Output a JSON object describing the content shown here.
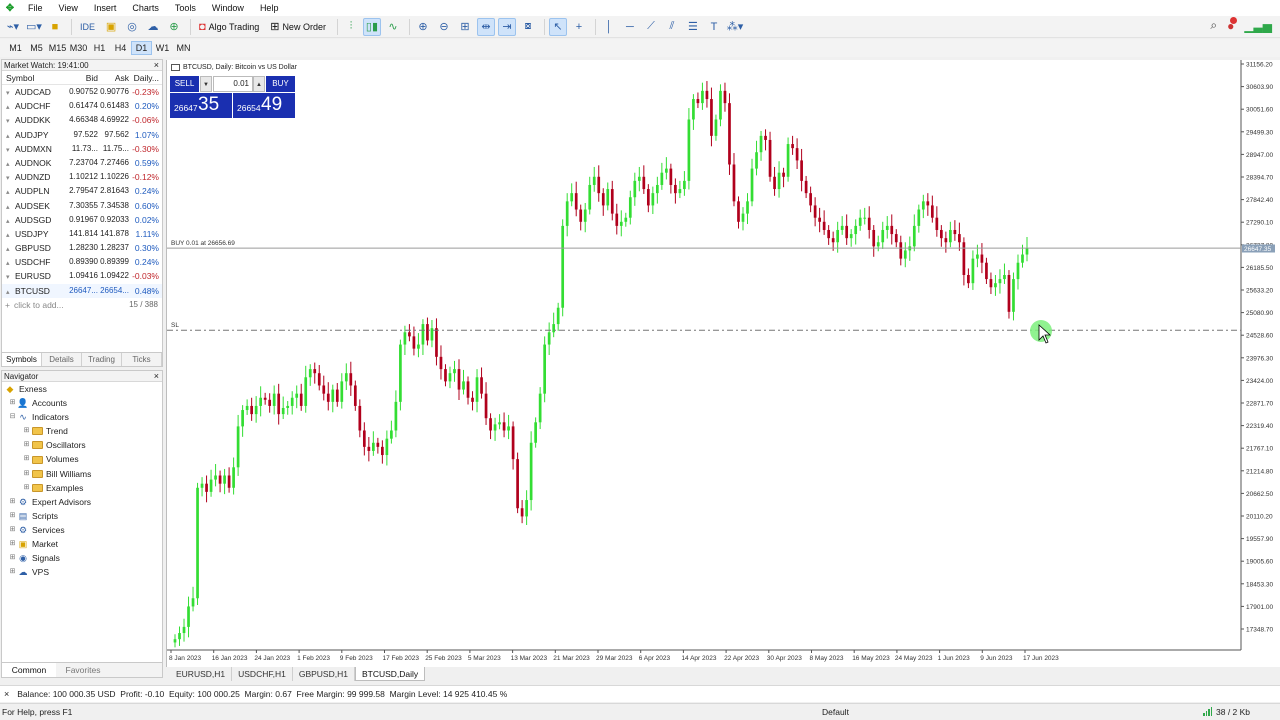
{
  "menu": [
    "File",
    "View",
    "Insert",
    "Charts",
    "Tools",
    "Window",
    "Help"
  ],
  "toolbar": {
    "ide_label": "IDE",
    "algo_trading_label": "Algo Trading",
    "new_order_label": "New Order"
  },
  "timeframes": [
    "M1",
    "M5",
    "M15",
    "M30",
    "H1",
    "H4",
    "D1",
    "W1",
    "MN"
  ],
  "active_timeframe": "D1",
  "market_watch": {
    "title": "Market Watch: 19:41:00",
    "headers": {
      "symbol": "Symbol",
      "bid": "Bid",
      "ask": "Ask",
      "change": "Daily..."
    },
    "rows": [
      {
        "symbol": "AUDCAD",
        "bid": "0.90752",
        "ask": "0.90776",
        "change": "-0.23%"
      },
      {
        "symbol": "AUDCHF",
        "bid": "0.61474",
        "ask": "0.61483",
        "change": "0.20%"
      },
      {
        "symbol": "AUDDKK",
        "bid": "4.66348",
        "ask": "4.69922",
        "change": "-0.06%"
      },
      {
        "symbol": "AUDJPY",
        "bid": "97.522",
        "ask": "97.562",
        "change": "1.07%"
      },
      {
        "symbol": "AUDMXN",
        "bid": "11.73...",
        "ask": "11.75...",
        "change": "-0.30%"
      },
      {
        "symbol": "AUDNOK",
        "bid": "7.23704",
        "ask": "7.27466",
        "change": "0.59%"
      },
      {
        "symbol": "AUDNZD",
        "bid": "1.10212",
        "ask": "1.10226",
        "change": "-0.12%"
      },
      {
        "symbol": "AUDPLN",
        "bid": "2.79547",
        "ask": "2.81643",
        "change": "0.24%"
      },
      {
        "symbol": "AUDSEK",
        "bid": "7.30355",
        "ask": "7.34538",
        "change": "0.60%"
      },
      {
        "symbol": "AUDSGD",
        "bid": "0.91967",
        "ask": "0.92033",
        "change": "0.02%"
      },
      {
        "symbol": "USDJPY",
        "bid": "141.814",
        "ask": "141.878",
        "change": "1.11%"
      },
      {
        "symbol": "GBPUSD",
        "bid": "1.28230",
        "ask": "1.28237",
        "change": "0.30%"
      },
      {
        "symbol": "USDCHF",
        "bid": "0.89390",
        "ask": "0.89399",
        "change": "0.24%"
      },
      {
        "symbol": "EURUSD",
        "bid": "1.09416",
        "ask": "1.09422",
        "change": "-0.03%"
      },
      {
        "symbol": "BTCUSD",
        "bid": "26647...",
        "ask": "26654...",
        "change": "0.48%"
      }
    ],
    "add_label": "click to add...",
    "count": "15 / 388",
    "tabs": [
      "Symbols",
      "Details",
      "Trading",
      "Ticks"
    ],
    "active_tab": "Symbols"
  },
  "navigator": {
    "title": "Navigator",
    "items": [
      {
        "label": "Exness",
        "level": 0,
        "icon": "exness-icon"
      },
      {
        "label": "Accounts",
        "level": 1,
        "icon": "accounts-icon"
      },
      {
        "label": "Indicators",
        "level": 1,
        "icon": "indicators-icon"
      },
      {
        "label": "Trend",
        "level": 2,
        "icon": "folder-icon"
      },
      {
        "label": "Oscillators",
        "level": 2,
        "icon": "folder-icon"
      },
      {
        "label": "Volumes",
        "level": 2,
        "icon": "folder-icon"
      },
      {
        "label": "Bill Williams",
        "level": 2,
        "icon": "folder-icon"
      },
      {
        "label": "Examples",
        "level": 2,
        "icon": "folder-icon"
      },
      {
        "label": "Expert Advisors",
        "level": 1,
        "icon": "expert-advisors-icon"
      },
      {
        "label": "Scripts",
        "level": 1,
        "icon": "scripts-icon"
      },
      {
        "label": "Services",
        "level": 1,
        "icon": "services-icon"
      },
      {
        "label": "Market",
        "level": 1,
        "icon": "market-icon"
      },
      {
        "label": "Signals",
        "level": 1,
        "icon": "signals-icon"
      },
      {
        "label": "VPS",
        "level": 1,
        "icon": "vps-icon"
      }
    ],
    "tabs": [
      "Common",
      "Favorites"
    ],
    "active_tab": "Common"
  },
  "chart": {
    "title": "BTCUSD, Daily:  Bitcoin vs US Dollar",
    "sell_label": "SELL",
    "buy_label": "BUY",
    "lot": "0.01",
    "sell_price_small": "26647",
    "sell_price_big": "35",
    "buy_price_small": "26654",
    "buy_price_big": "49",
    "buy_line_label": "BUY 0.01 at 26656.69",
    "sl_label": "SL",
    "current_price_label": "26647.35",
    "colors": {
      "bull": "#33dd33",
      "bear": "#b0001c",
      "trade_line": "#9a9a9a"
    }
  },
  "chart_data": {
    "type": "candlestick",
    "title": "BTCUSD, Daily:  Bitcoin vs US Dollar",
    "y_tick_labels": [
      "31156.20",
      "30603.90",
      "30051.60",
      "29499.30",
      "28947.00",
      "28394.70",
      "27842.40",
      "27290.10",
      "26737.80",
      "26185.50",
      "25633.20",
      "25080.90",
      "24528.60",
      "23976.30",
      "23424.00",
      "22871.70",
      "22319.40",
      "21767.10",
      "21214.80",
      "20662.50",
      "20110.20",
      "19557.90",
      "19005.60",
      "18453.30",
      "17901.00",
      "17348.70"
    ],
    "x_tick_labels": [
      "8 Jan 2023",
      "16 Jan 2023",
      "24 Jan 2023",
      "1 Feb 2023",
      "9 Feb 2023",
      "17 Feb 2023",
      "25 Feb 2023",
      "5 Mar 2023",
      "13 Mar 2023",
      "21 Mar 2023",
      "29 Mar 2023",
      "6 Apr 2023",
      "14 Apr 2023",
      "22 Apr 2023",
      "30 Apr 2023",
      "8 May 2023",
      "16 May 2023",
      "24 May 2023",
      "1 Jun 2023",
      "9 Jun 2023",
      "17 Jun 2023"
    ],
    "ylim": [
      17000,
      31300
    ],
    "buy_level": 26656.69,
    "sl_level": 24650,
    "candles_close": [
      17100,
      17250,
      17400,
      17900,
      18100,
      20800,
      20900,
      20700,
      21000,
      21100,
      20900,
      21100,
      20800,
      21300,
      22300,
      22700,
      22800,
      22600,
      22800,
      23000,
      22950,
      22800,
      23100,
      22600,
      22750,
      22800,
      23000,
      23100,
      22800,
      23500,
      23700,
      23600,
      23300,
      23100,
      22900,
      23200,
      22900,
      23400,
      23600,
      23300,
      22800,
      22200,
      21800,
      21700,
      21900,
      21800,
      21600,
      22000,
      22200,
      22900,
      24300,
      24600,
      24500,
      24200,
      24300,
      24800,
      24400,
      24700,
      24000,
      23700,
      23400,
      23600,
      23700,
      23200,
      23400,
      23000,
      22900,
      23500,
      23100,
      22500,
      22200,
      22350,
      22400,
      22200,
      22300,
      21500,
      20300,
      20100,
      20500,
      21900,
      22400,
      23100,
      24300,
      24600,
      24800,
      25200,
      27200,
      27800,
      28000,
      27600,
      27300,
      27600,
      28200,
      28400,
      28000,
      27700,
      28100,
      27500,
      27200,
      27300,
      27400,
      27900,
      28300,
      28400,
      28100,
      27700,
      28000,
      28200,
      28500,
      28600,
      28200,
      28000,
      28100,
      28300,
      29800,
      30300,
      30200,
      30500,
      30300,
      29400,
      29800,
      30500,
      30200,
      28700,
      27800,
      27300,
      27500,
      27800,
      28600,
      29000,
      29400,
      29300,
      28400,
      28100,
      28500,
      28400,
      29200,
      29100,
      28800,
      28300,
      28000,
      27700,
      27400,
      27300,
      27100,
      26900,
      26800,
      27100,
      27200,
      26900,
      27000,
      27200,
      27400,
      27400,
      27100,
      26700,
      26800,
      27100,
      27200,
      27000,
      26800,
      26400,
      26600,
      26700,
      27200,
      27600,
      27800,
      27700,
      27400,
      27100,
      26900,
      26800,
      27100,
      27000,
      26800,
      26000,
      25800,
      26400,
      26500,
      26300,
      25900,
      25700,
      25800,
      25900,
      26000,
      25100,
      25900,
      26300,
      26500,
      26647
    ]
  }
}
